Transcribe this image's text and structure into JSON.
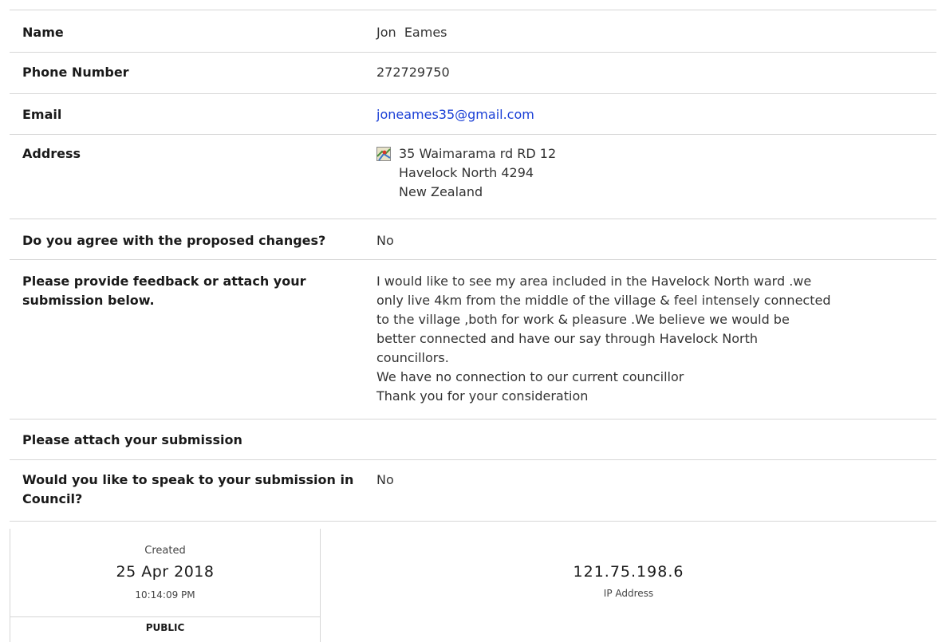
{
  "fields": {
    "name": {
      "label": "Name",
      "value": "Jon  Eames"
    },
    "phone": {
      "label": "Phone Number",
      "value": "272729750"
    },
    "email": {
      "label": "Email",
      "value": "joneames35@gmail.com"
    },
    "address": {
      "label": "Address",
      "icon": "map-icon",
      "lines": [
        "35 Waimarama rd RD 12",
        "Havelock North 4294",
        "New Zealand"
      ]
    },
    "agree": {
      "label": "Do you agree with the proposed changes?",
      "value": "No"
    },
    "feedback": {
      "label": "Please provide feedback or attach your submission below.",
      "lines": [
        "I would like to see my area included in the Havelock North ward .we",
        "only live 4km from the middle of the village & feel intensely connected",
        "to the village ,both for work & pleasure .We believe we would be",
        "better connected and have our say through Havelock North",
        "councillors.",
        "We have no connection to our current councillor",
        "Thank you for your consideration"
      ]
    },
    "attach": {
      "label": "Please attach your submission",
      "value": ""
    },
    "speak": {
      "label": "Would you like to speak to your submission in Council?",
      "value": "No"
    }
  },
  "meta": {
    "created_label": "Created",
    "created_date": "25 Apr 2018",
    "created_time": "10:14:09 PM",
    "visibility": "PUBLIC",
    "ip": "121.75.198.6",
    "ip_label": "IP Address"
  }
}
